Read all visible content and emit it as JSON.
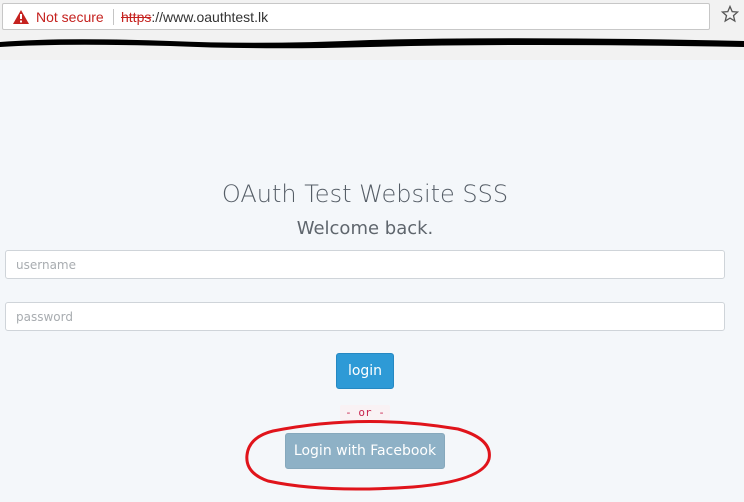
{
  "browser": {
    "security_label": "Not secure",
    "url_scheme": "https",
    "url_rest": "://www.oauthtest.lk",
    "warn_color": "#c5221f",
    "star_icon": "bookmark-star-icon"
  },
  "page": {
    "title": "OAuth Test Website SSS",
    "subtitle": "Welcome back.",
    "username_placeholder": "username",
    "password_placeholder": "password",
    "login_label": "login",
    "or_separator": "- or -",
    "facebook_label": "Login with Facebook",
    "accent_color": "#2e9ad6",
    "annotation_color": "#e0141b"
  }
}
